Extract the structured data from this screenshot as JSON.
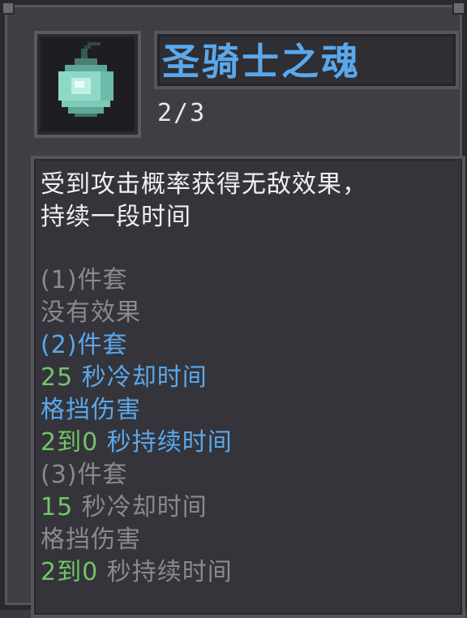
{
  "item": {
    "name": "圣骑士之魂",
    "count": "2/3",
    "icon": "soul-orb-icon",
    "description": [
      "受到攻击概率获得无敌效果，",
      "持续一段时间"
    ]
  },
  "set_bonuses": [
    {
      "header": "(1)件套",
      "state": "inactive",
      "lines": [
        {
          "num": "",
          "text": "没有效果"
        }
      ]
    },
    {
      "header": "(2)件套",
      "state": "active",
      "lines": [
        {
          "num": "25",
          "text": " 秒冷却时间"
        },
        {
          "num": "",
          "text": "格挡伤害"
        },
        {
          "num": "2到0",
          "text": " 秒持续时间"
        }
      ]
    },
    {
      "header": "(3)件套",
      "state": "inactive",
      "lines": [
        {
          "num": "15",
          "text": " 秒冷却时间"
        },
        {
          "num": "",
          "text": "格挡伤害"
        },
        {
          "num": "2到0",
          "text": " 秒持续时间"
        }
      ]
    }
  ],
  "colors": {
    "active": "#5aa8ec",
    "inactive": "#8a8a8e",
    "number": "#74c46a",
    "title": "#5aa8ec"
  }
}
